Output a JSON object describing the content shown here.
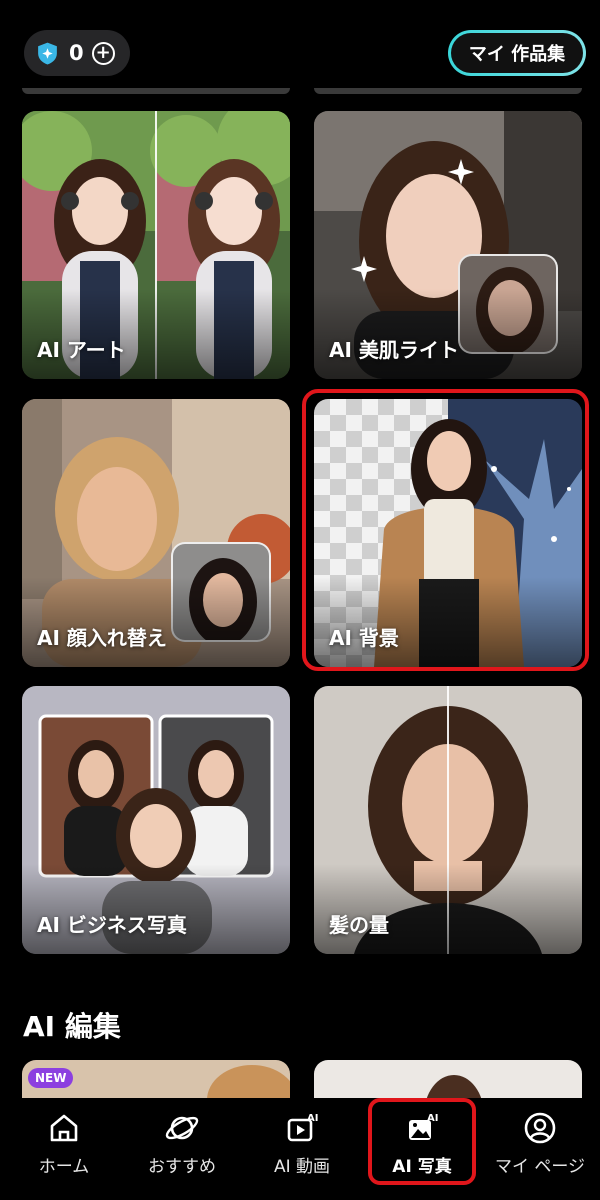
{
  "header": {
    "credits_count": "0",
    "credits_icon": "shield-star-icon",
    "works_button": "マイ 作品集",
    "accent_color": "#39d6d9"
  },
  "cards": [
    {
      "label": "AI アート"
    },
    {
      "label": "AI 美肌ライト"
    },
    {
      "label": "AI 顔入れ替え"
    },
    {
      "label": "AI 背景"
    },
    {
      "label": "AI ビジネス写真"
    },
    {
      "label": "髪の量"
    }
  ],
  "section": {
    "title": "AI 編集",
    "badge": "NEW"
  },
  "nav": {
    "items": [
      {
        "label": "ホーム",
        "icon": "home-icon"
      },
      {
        "label": "おすすめ",
        "icon": "planet-icon"
      },
      {
        "label": "AI 動画",
        "icon": "ai-video-icon"
      },
      {
        "label": "AI 写真",
        "icon": "ai-photo-icon"
      },
      {
        "label": "マイ ページ",
        "icon": "user-icon"
      }
    ],
    "active_index": 3,
    "highlight_color": "#e0161b"
  }
}
